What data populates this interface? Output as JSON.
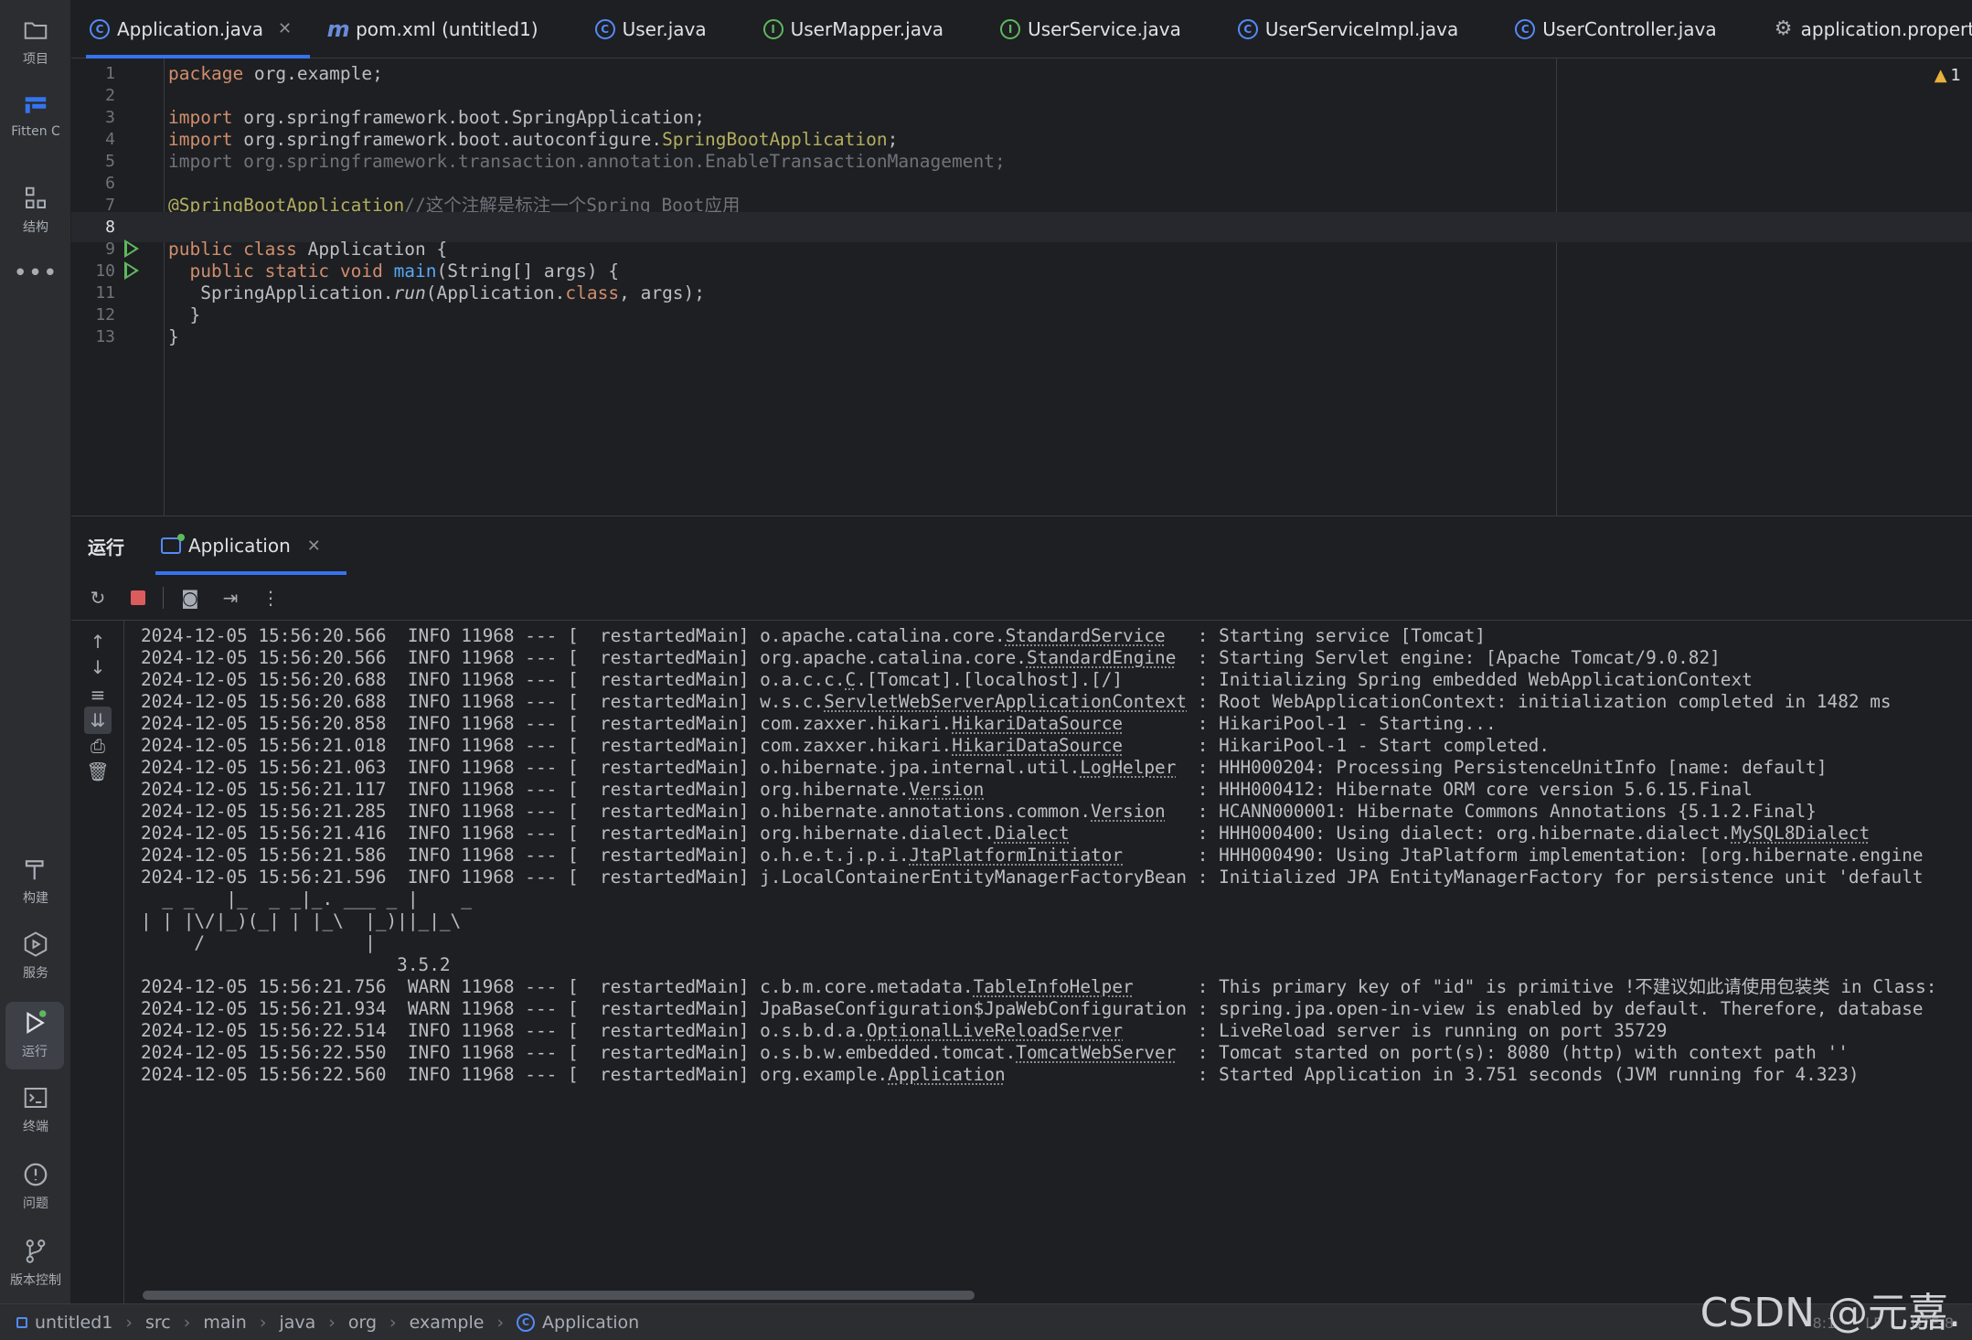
{
  "leftbar": {
    "top": [
      {
        "name": "project",
        "icon": "folder-icon",
        "label": "项目"
      },
      {
        "name": "fitten",
        "icon": "fitten-code-icon",
        "label": "Fitten C"
      },
      {
        "name": "structure",
        "icon": "structure-icon",
        "label": "结构"
      },
      {
        "name": "more",
        "icon": "more-icon",
        "label": ""
      }
    ],
    "bottom": [
      {
        "name": "build",
        "icon": "hammer-icon",
        "label": "构建"
      },
      {
        "name": "services",
        "icon": "services-icon",
        "label": "服务"
      },
      {
        "name": "run",
        "icon": "run-icon",
        "label": "运行"
      },
      {
        "name": "terminal",
        "icon": "terminal-icon",
        "label": "终端"
      },
      {
        "name": "problems",
        "icon": "problems-icon",
        "label": "问题"
      },
      {
        "name": "vcs",
        "icon": "vcs-icon",
        "label": "版本控制"
      }
    ]
  },
  "tabs": [
    {
      "label": "Application.java",
      "icon": "class-icon",
      "active": true
    },
    {
      "label": "pom.xml (untitled1)",
      "icon": "maven-icon"
    },
    {
      "label": "User.java",
      "icon": "class-icon"
    },
    {
      "label": "UserMapper.java",
      "icon": "interface-icon"
    },
    {
      "label": "UserService.java",
      "icon": "interface-icon"
    },
    {
      "label": "UserServiceImpl.java",
      "icon": "class-icon"
    },
    {
      "label": "UserController.java",
      "icon": "class-icon"
    },
    {
      "label": "application.properties",
      "icon": "gear-icon"
    }
  ],
  "editor": {
    "warning_count": "1",
    "line_numbers": [
      "1",
      "2",
      "3",
      "4",
      "5",
      "6",
      "7",
      "8",
      "9",
      "10",
      "11",
      "12",
      "13"
    ],
    "current_line": "8"
  },
  "run_panel": {
    "title": "运行",
    "tab_label": "Application"
  },
  "console": {
    "banner": [
      "  _ _   |_  _ _|_. ___ _ |    _",
      "| | |\\/|_)(_| | |_\\  |_)||_|_\\",
      "     /               |",
      "                        3.5.2"
    ]
  },
  "statusbar": {
    "breadcrumb": [
      "untitled1",
      "src",
      "main",
      "java",
      "org",
      "example",
      "Application"
    ],
    "position": "8:1",
    "line_sep": "LF",
    "encoding": "UTF-8"
  },
  "watermark": "CSDN @元嘉."
}
